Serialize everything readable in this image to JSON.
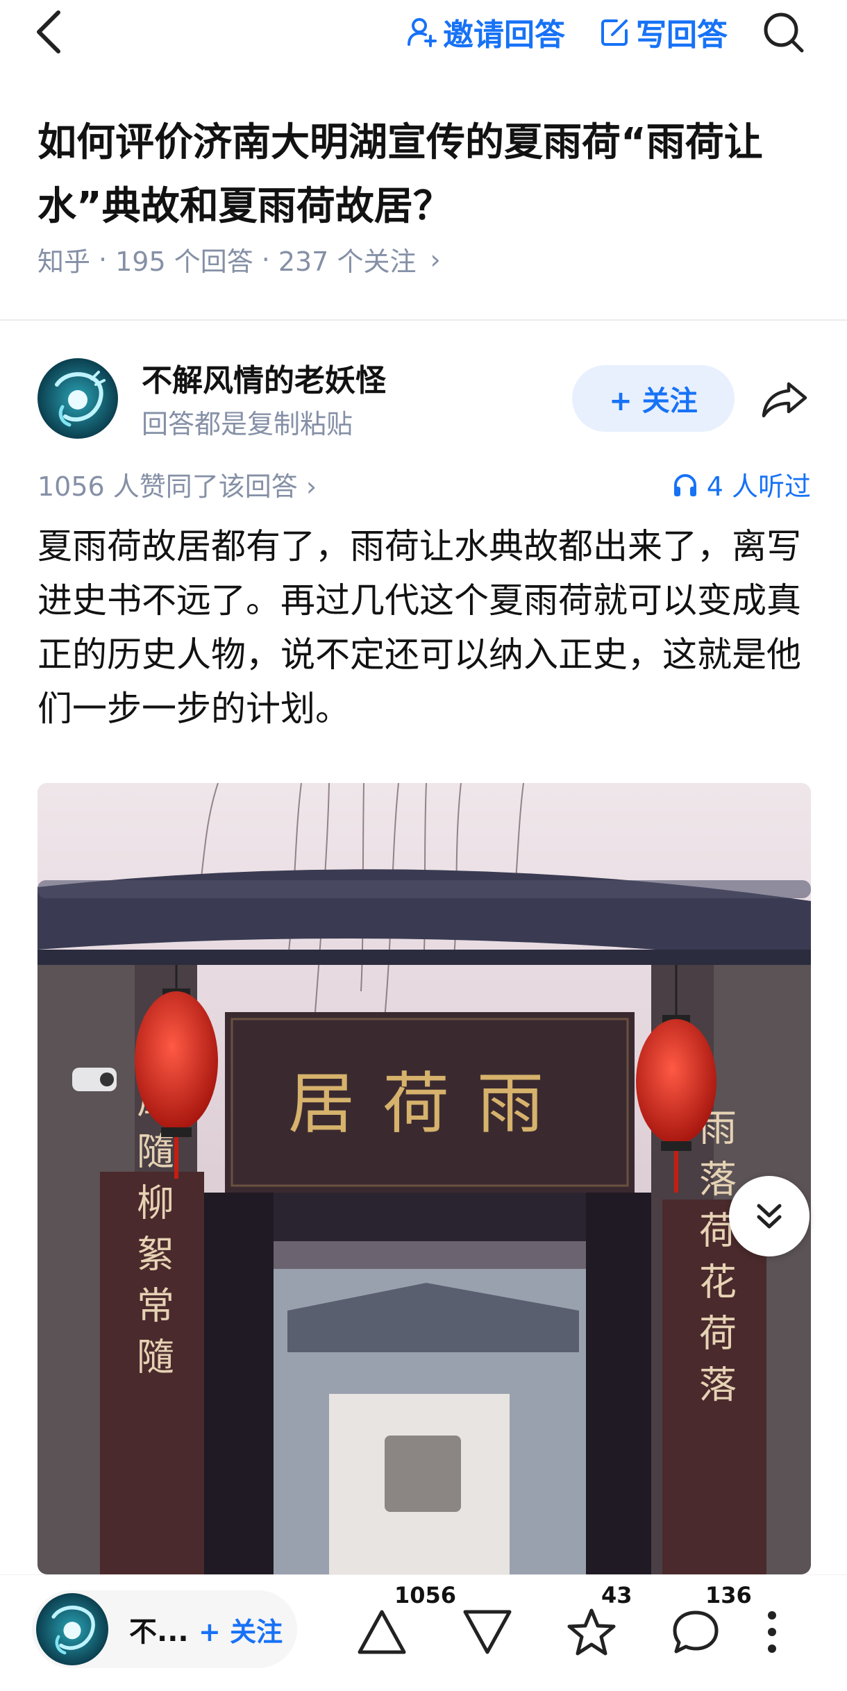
{
  "topbar": {
    "invite_label": "邀请回答",
    "write_label": "写回答"
  },
  "question": {
    "title": "如何评价济南大明湖宣传的夏雨荷“雨荷让水”典故和夏雨荷故居？",
    "source": "知乎",
    "answers": "195 个回答",
    "followers": "237 个关注",
    "sep": "·",
    "chevron": "›"
  },
  "author": {
    "name": "不解风情的老妖怪",
    "bio": "回答都是复制粘贴",
    "follow_label": "+ 关注"
  },
  "answer": {
    "votes_text": "1056 人赞同了该回答 ›",
    "listened_text": "4 人听过",
    "body": "夏雨荷故居都有了，雨荷让水典故都出来了，离写进史书不远了。再过几代这个夏雨荷就可以变成真正的历史人物，说不定还可以纳入正史，这就是他们一步一步的计划。"
  },
  "photo": {
    "plaque_text": "居荷雨",
    "left_couplet": "風隨柳絮常隨",
    "right_couplet": "雨落荷花荷落"
  },
  "bottombar": {
    "name_short": "不...",
    "follow_label": "+ 关注",
    "upvotes": "1056",
    "favorites": "43",
    "comments": "136"
  },
  "colors": {
    "accent": "#1772f6",
    "meta": "#8590a6",
    "lantern": "#d42a1e"
  }
}
